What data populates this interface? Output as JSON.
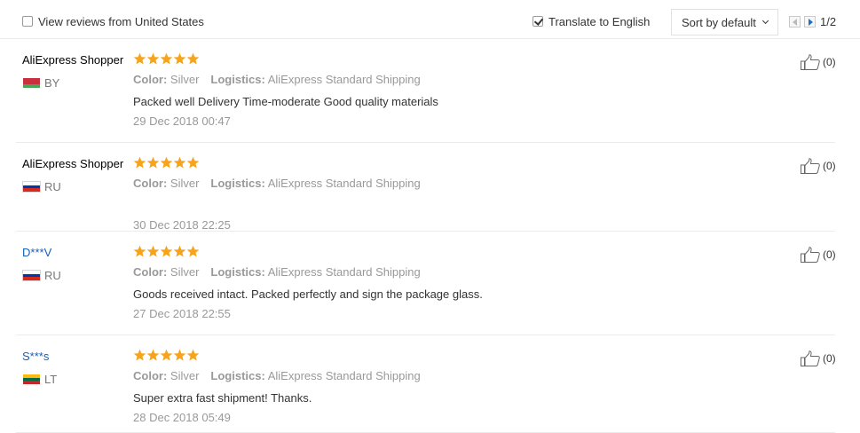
{
  "filters": {
    "view_reviews_label": "View reviews from United States",
    "view_reviews_checked": false,
    "translate_label": "Translate to English",
    "translate_checked": true,
    "sort_label": "Sort by default",
    "page_indicator": "1/2"
  },
  "colors": {
    "star": "#f7a41d",
    "link": "#1a5fb4",
    "muted": "#999999"
  },
  "reviews": [
    {
      "name": "AliExpress Shopper",
      "name_is_link": false,
      "country_code": "BY",
      "flag": [
        "#c8313e",
        "#c8313e",
        "#4aa657"
      ],
      "rating": 5,
      "color_label": "Color:",
      "color_value": "Silver",
      "logistics_label": "Logistics:",
      "logistics_value": "AliExpress Standard Shipping",
      "comment": "Packed well Delivery Time-moderate Good quality materials",
      "date": "29 Dec 2018 00:47",
      "likes": "(0)"
    },
    {
      "name": "AliExpress Shopper",
      "name_is_link": false,
      "country_code": "RU",
      "flag": [
        "#ffffff",
        "#0039a6",
        "#d52b1e"
      ],
      "rating": 5,
      "color_label": "Color:",
      "color_value": "Silver",
      "logistics_label": "Logistics:",
      "logistics_value": "AliExpress Standard Shipping",
      "comment": "",
      "date": "30 Dec 2018 22:25",
      "likes": "(0)"
    },
    {
      "name": "D***V",
      "name_is_link": true,
      "country_code": "RU",
      "flag": [
        "#ffffff",
        "#0039a6",
        "#d52b1e"
      ],
      "rating": 5,
      "color_label": "Color:",
      "color_value": "Silver",
      "logistics_label": "Logistics:",
      "logistics_value": "AliExpress Standard Shipping",
      "comment": "Goods received intact. Packed perfectly and sign the package glass.",
      "date": "27 Dec 2018 22:55",
      "likes": "(0)"
    },
    {
      "name": "S***s",
      "name_is_link": true,
      "country_code": "LT",
      "flag": [
        "#fdb913",
        "#006a44",
        "#c1272d"
      ],
      "rating": 5,
      "color_label": "Color:",
      "color_value": "Silver",
      "logistics_label": "Logistics:",
      "logistics_value": "AliExpress Standard Shipping",
      "comment": "Super extra fast shipment! Thanks.",
      "date": "28 Dec 2018 05:49",
      "likes": "(0)"
    }
  ]
}
